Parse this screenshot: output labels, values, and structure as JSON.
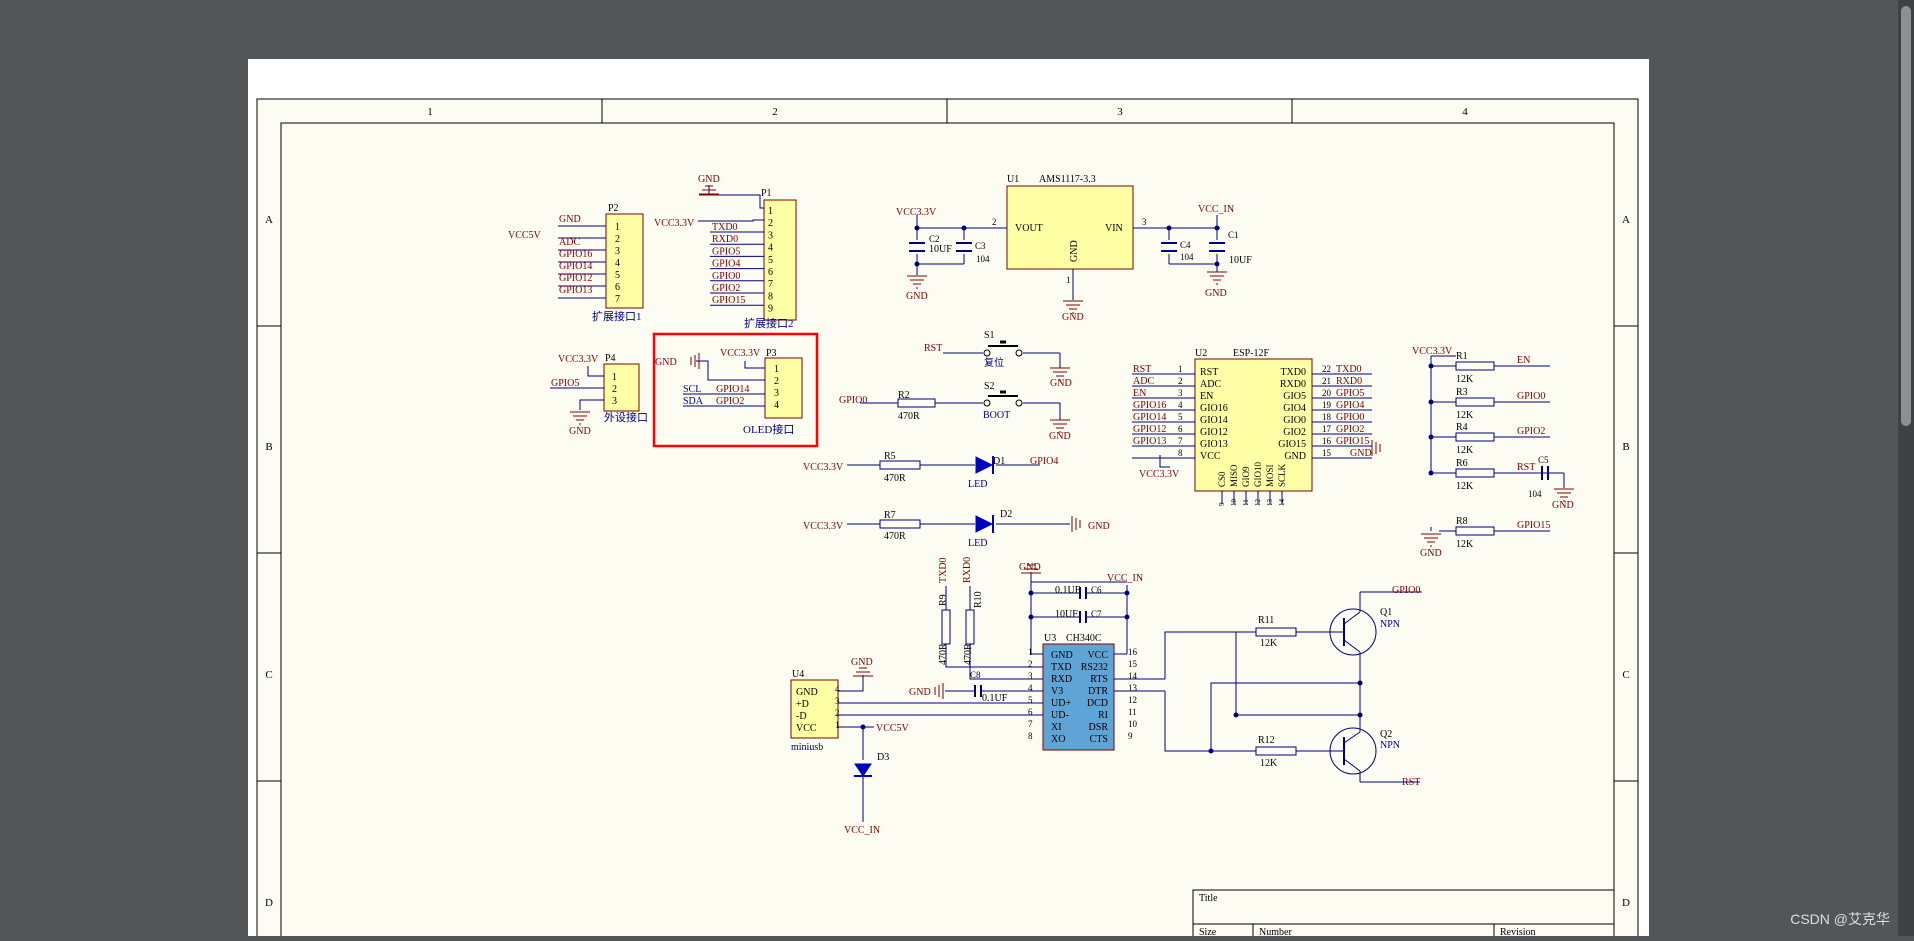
{
  "viewer": {
    "watermark": "CSDN @艾克华"
  },
  "sheet": {
    "columns": [
      "1",
      "2",
      "3",
      "4"
    ],
    "rows": [
      "A",
      "B",
      "C",
      "D"
    ],
    "title_block": {
      "title": "Title",
      "size": "Size",
      "number": "Number",
      "revision": "Revision"
    }
  },
  "p2": {
    "ref": "P2",
    "caption": "扩展接口1",
    "pins": [
      "1",
      "2",
      "3",
      "4",
      "5",
      "6",
      "7"
    ],
    "nets": [
      "GND",
      "VCC5V",
      "ADC",
      "GPIO16",
      "GPIO14",
      "GPIO12",
      "GPIO13"
    ]
  },
  "p1": {
    "ref": "P1",
    "caption": "扩展接口2",
    "top_net": "GND",
    "side_net": "VCC3.3V",
    "pins": [
      "1",
      "2",
      "3",
      "4",
      "5",
      "6",
      "7",
      "8",
      "9"
    ],
    "nets": [
      "TXD0",
      "RXD0",
      "GPIO5",
      "GPIO4",
      "GPIO0",
      "GPIO2",
      "GPIO15"
    ]
  },
  "p4": {
    "ref": "P4",
    "caption": "外设接口",
    "pins": [
      "1",
      "2",
      "3"
    ],
    "nets": [
      "VCC3.3V",
      "GPIO5",
      "GND"
    ]
  },
  "p3": {
    "ref": "P3",
    "caption": "OLED接口",
    "pins": [
      "1",
      "2",
      "3",
      "4"
    ],
    "nets": [
      "GND",
      "VCC3.3V",
      "SCL",
      "GPIO14",
      "SDA",
      "GPIO2"
    ]
  },
  "u1": {
    "ref": "U1",
    "part": "AMS1117-3.3",
    "vout": "VOUT",
    "vin": "VIN",
    "gnd": "GND",
    "pin_vout": "2",
    "pin_vin": "3",
    "pin_gnd": "1",
    "net_left": "VCC3.3V",
    "net_right": "VCC_IN",
    "gnd_bottom": "GND"
  },
  "caps_power": [
    {
      "ref": "C2",
      "value": "10UF",
      "gnd": "GND"
    },
    {
      "ref": "C3",
      "value": "104"
    },
    {
      "ref": "C4",
      "value": "104"
    },
    {
      "ref": "C1",
      "value": "10UF",
      "gnd": "GND"
    }
  ],
  "switches": [
    {
      "ref": "S1",
      "name": "复位",
      "net": "RST",
      "gnd": "GND"
    },
    {
      "ref": "S2",
      "name": "BOOT",
      "net": "GPIO0",
      "res_ref": "R2",
      "res_val": "470R",
      "gnd": "GND"
    }
  ],
  "leds": [
    {
      "net": "VCC3.3V",
      "res_ref": "R5",
      "res_val": "470R",
      "ref": "D1",
      "name": "LED",
      "out": "GPIO4"
    },
    {
      "net": "VCC3.3V",
      "res_ref": "R7",
      "res_val": "470R",
      "ref": "D2",
      "name": "LED",
      "out": "GND"
    }
  ],
  "u2": {
    "ref": "U2",
    "part": "ESP-12F",
    "left_pins": [
      {
        "num": "1",
        "name": "RST",
        "net": "RST"
      },
      {
        "num": "2",
        "name": "ADC",
        "net": "ADC"
      },
      {
        "num": "3",
        "name": "EN",
        "net": "EN"
      },
      {
        "num": "4",
        "name": "GIO16",
        "net": "GPIO16"
      },
      {
        "num": "5",
        "name": "GIO14",
        "net": "GPIO14"
      },
      {
        "num": "6",
        "name": "GIO12",
        "net": "GPIO12"
      },
      {
        "num": "7",
        "name": "GIO13",
        "net": "GPIO13"
      },
      {
        "num": "8",
        "name": "VCC",
        "net": ""
      }
    ],
    "right_pins": [
      {
        "num": "22",
        "name": "TXD0",
        "net": "TXD0"
      },
      {
        "num": "21",
        "name": "RXD0",
        "net": "RXD0"
      },
      {
        "num": "20",
        "name": "GIO5",
        "net": "GPIO5"
      },
      {
        "num": "19",
        "name": "GIO4",
        "net": "GPIO4"
      },
      {
        "num": "18",
        "name": "GIO0",
        "net": "GPIO0"
      },
      {
        "num": "17",
        "name": "GIO2",
        "net": "GPIO2"
      },
      {
        "num": "16",
        "name": "GIO15",
        "net": "GPIO15"
      },
      {
        "num": "15",
        "name": "GND",
        "net": "GND"
      }
    ],
    "bottom_pins": [
      "CS0",
      "MISO",
      "GIO9",
      "GIO10",
      "MOSI",
      "SCLK"
    ],
    "bottom_nums": [
      "9",
      "10",
      "11",
      "12",
      "13",
      "14"
    ],
    "vcc_net": "VCC3.3V"
  },
  "pullups": {
    "net": "VCC3.3V",
    "gnd": "GND",
    "items": [
      {
        "ref": "R1",
        "val": "12K",
        "net": "EN"
      },
      {
        "ref": "R3",
        "val": "12K",
        "net": "GPIO0"
      },
      {
        "ref": "R4",
        "val": "12K",
        "net": "GPIO2"
      },
      {
        "ref": "R6",
        "val": "12K",
        "net": "RST"
      },
      {
        "ref": "R8",
        "val": "12K",
        "net": "GPIO15"
      }
    ],
    "c5_ref": "C5",
    "c5_val": "104",
    "c5_gnd": "GND"
  },
  "u3": {
    "ref": "U3",
    "part": "CH340C",
    "left_pins": [
      {
        "num": "1",
        "name": "GND"
      },
      {
        "num": "2",
        "name": "TXD"
      },
      {
        "num": "3",
        "name": "RXD"
      },
      {
        "num": "4",
        "name": "V3"
      },
      {
        "num": "5",
        "name": "UD+"
      },
      {
        "num": "6",
        "name": "UD-"
      },
      {
        "num": "7",
        "name": "XI"
      },
      {
        "num": "8",
        "name": "XO"
      }
    ],
    "right_pins": [
      {
        "num": "16",
        "name": "VCC"
      },
      {
        "num": "15",
        "name": "RS232"
      },
      {
        "num": "14",
        "name": "RTS"
      },
      {
        "num": "13",
        "name": "DTR"
      },
      {
        "num": "12",
        "name": "DCD"
      },
      {
        "num": "11",
        "name": "RI"
      },
      {
        "num": "10",
        "name": "DSR"
      },
      {
        "num": "9",
        "name": "CTS"
      }
    ],
    "gnd_top": "GND",
    "vcc_top": "VCC_IN",
    "c6": "0.1UF",
    "c6_ref": "C6",
    "c7": "10UF",
    "c7_ref": "C7",
    "r9_ref": "R9",
    "r9_val": "470R",
    "r9_net": "TXD0",
    "r10_ref": "R10",
    "r10_val": "470R",
    "r10_net": "RXD0",
    "c8_ref": "C8",
    "c8_val": "0.1UF",
    "c8_gnd": "GND"
  },
  "u4": {
    "ref": "U4",
    "part": "miniusb",
    "gnd_top": "GND",
    "pins": [
      {
        "num": "4",
        "name": "GND"
      },
      {
        "num": "3",
        "name": "+D"
      },
      {
        "num": "2",
        "name": "-D"
      },
      {
        "num": "1",
        "name": "VCC"
      }
    ],
    "vcc_net": "VCC5V",
    "d3_ref": "D3",
    "d3_net": "VCC_IN"
  },
  "transistors": [
    {
      "ref": "Q1",
      "type": "NPN",
      "res_ref": "R11",
      "res_val": "12K",
      "net": "GPIO0"
    },
    {
      "ref": "Q2",
      "type": "NPN",
      "res_ref": "R12",
      "res_val": "12K",
      "net": "RST"
    }
  ]
}
